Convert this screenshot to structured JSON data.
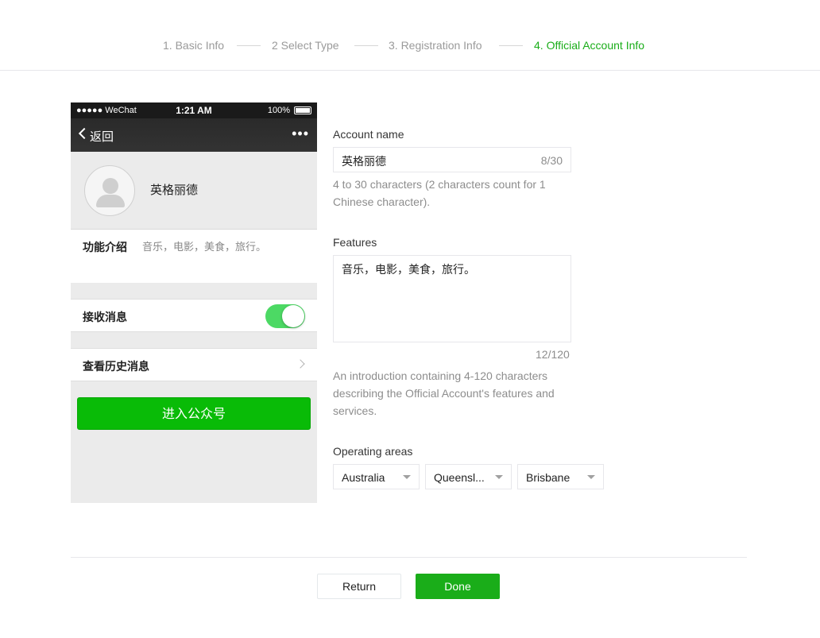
{
  "stepper": {
    "steps": [
      {
        "label": "1. Basic Info",
        "active": false
      },
      {
        "label": "2 Select Type",
        "active": false
      },
      {
        "label": "3. Registration Info",
        "active": false
      },
      {
        "label": "4. Official Account Info",
        "active": true
      }
    ],
    "active_color": "#1aad19"
  },
  "preview": {
    "status_bar": {
      "carrier": "●●●●● WeChat",
      "time": "1:21 AM",
      "battery": "100%"
    },
    "nav": {
      "back_label": "返回",
      "more": "•••"
    },
    "profile_name": "英格丽德",
    "intro_label": "功能介绍",
    "intro_value": "音乐，电影，美食，旅行。",
    "receive_label": "接收消息",
    "receive_enabled": true,
    "history_label": "查看历史消息",
    "enter_button": "进入公众号",
    "button_color": "#09bb07"
  },
  "form": {
    "account_name": {
      "label": "Account name",
      "value": "英格丽德",
      "counter": "8/30",
      "hint": "4 to 30 characters (2 characters count for 1 Chinese character)."
    },
    "features": {
      "label": "Features",
      "value": "音乐，电影，美食，旅行。",
      "counter": "12/120",
      "hint": "An introduction containing 4-120 characters describing the Official Account's features and services."
    },
    "operating_areas": {
      "label": "Operating areas",
      "country": "Australia",
      "state": "Queensl...",
      "city": "Brisbane"
    }
  },
  "footer": {
    "return_label": "Return",
    "done_label": "Done"
  }
}
